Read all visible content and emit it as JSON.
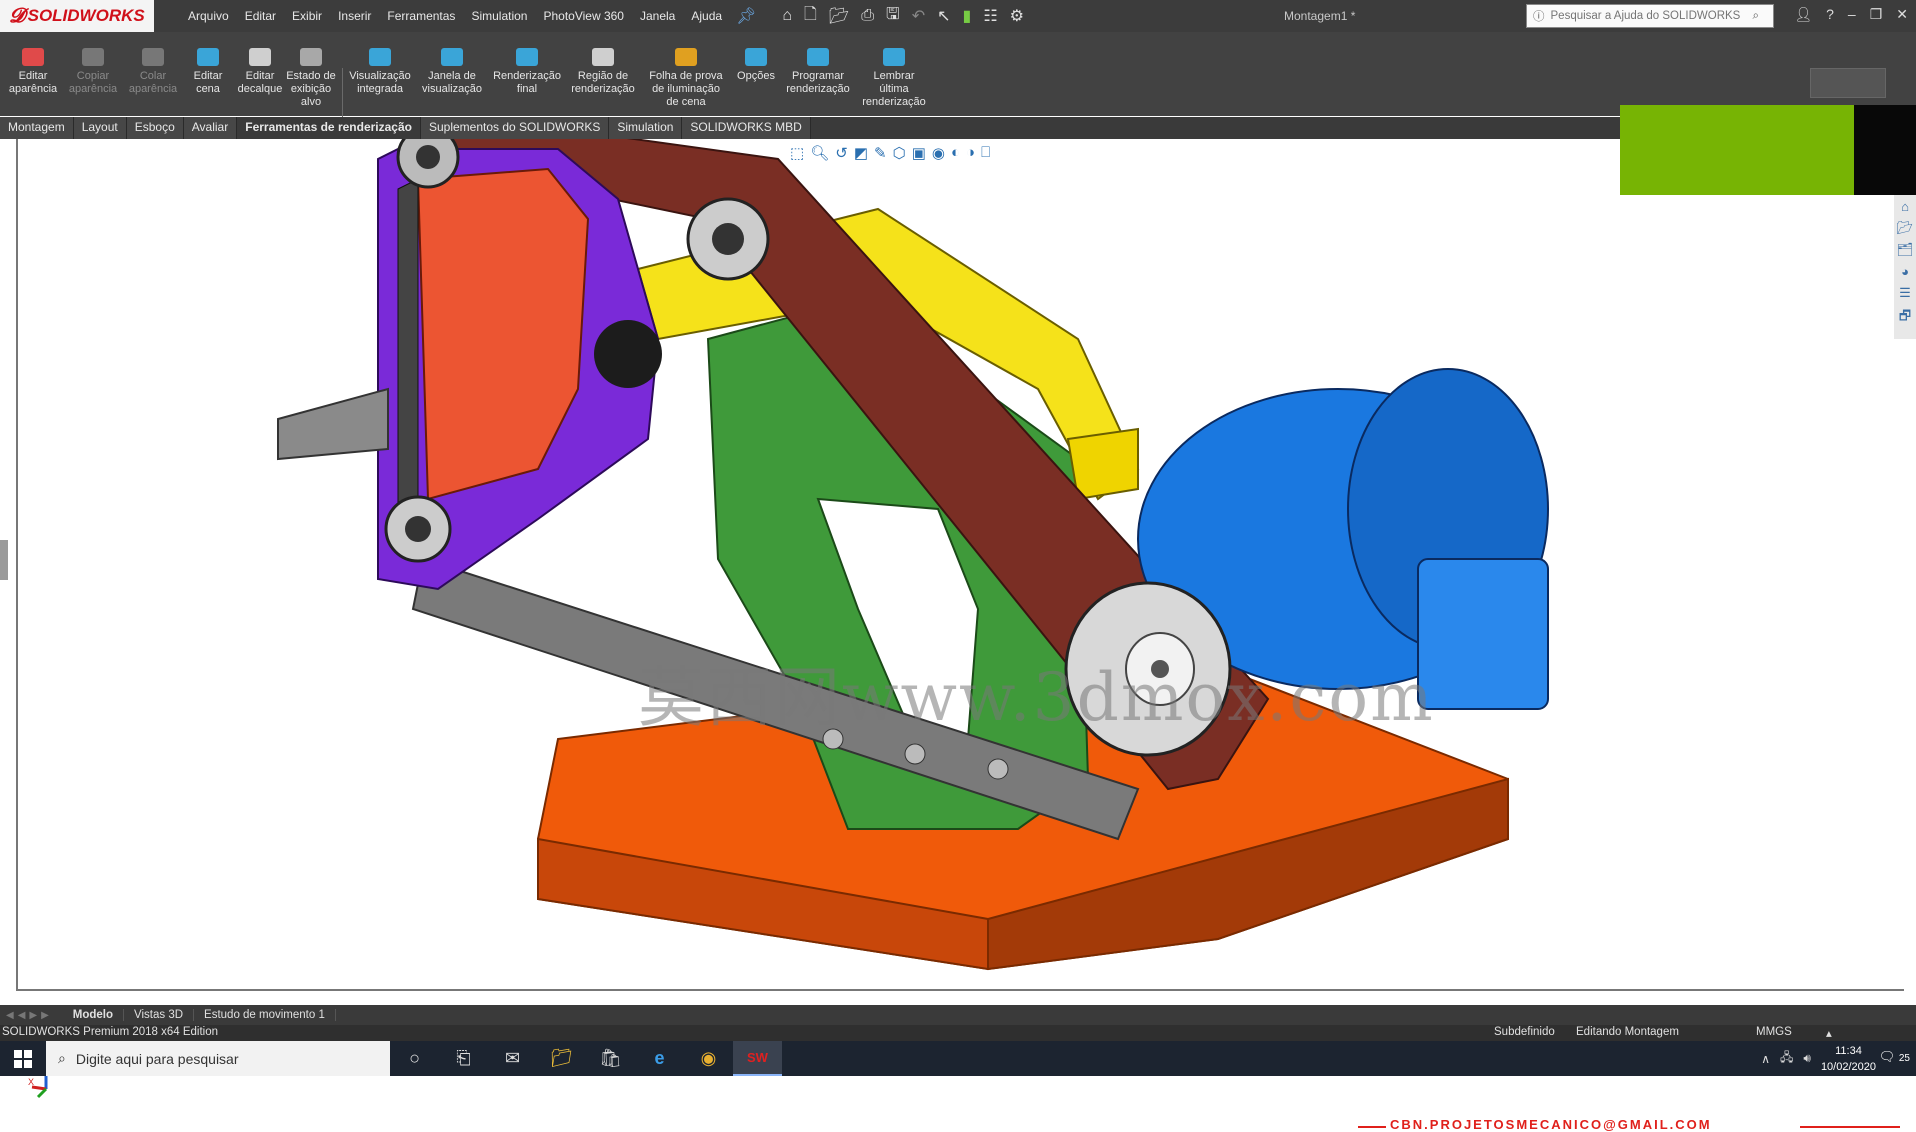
{
  "app": {
    "logo_text": "SOLIDWORKS",
    "document_title": "Montagem1 *",
    "menu": [
      "Arquivo",
      "Editar",
      "Exibir",
      "Inserir",
      "Ferramentas",
      "Simulation",
      "PhotoView 360",
      "Janela",
      "Ajuda"
    ],
    "search_placeholder": "Pesquisar a Ajuda do SOLIDWORKS"
  },
  "commands": [
    {
      "label": "Editar aparência",
      "enabled": true,
      "icon": "edit-appearance-icon",
      "color": "#e04a4a"
    },
    {
      "label": "Copiar aparência",
      "enabled": false,
      "icon": "copy-appearance-icon",
      "color": "#777777"
    },
    {
      "label": "Colar aparência",
      "enabled": false,
      "icon": "paste-appearance-icon",
      "color": "#777777"
    },
    {
      "label": "Editar cena",
      "enabled": true,
      "icon": "edit-scene-icon",
      "color": "#3aa5d8"
    },
    {
      "label": "Editar decalque",
      "enabled": true,
      "icon": "edit-decal-icon",
      "color": "#cfcfcf"
    },
    {
      "label": "Estado de exibição alvo",
      "enabled": true,
      "icon": "display-state-icon",
      "color": "#a8a8a8"
    },
    {
      "label": "Visualização integrada",
      "enabled": true,
      "icon": "integrated-preview-icon",
      "color": "#3aa5d8"
    },
    {
      "label": "Janela de visualização",
      "enabled": true,
      "icon": "preview-window-icon",
      "color": "#3aa5d8"
    },
    {
      "label": "Renderização final",
      "enabled": true,
      "icon": "final-render-icon",
      "color": "#3aa5d8"
    },
    {
      "label": "Região de renderização",
      "enabled": true,
      "icon": "render-region-icon",
      "color": "#cfcfcf"
    },
    {
      "label": "Folha de prova de iluminação de cena",
      "enabled": true,
      "icon": "scene-proofsheet-icon",
      "color": "#e0a020"
    },
    {
      "label": "Opções",
      "enabled": true,
      "icon": "options-icon",
      "color": "#3aa5d8"
    },
    {
      "label": "Programar renderização",
      "enabled": true,
      "icon": "schedule-render-icon",
      "color": "#3aa5d8"
    },
    {
      "label": "Lembrar última renderização",
      "enabled": true,
      "icon": "recall-render-icon",
      "color": "#3aa5d8"
    }
  ],
  "tabs": [
    {
      "label": "Montagem",
      "active": false
    },
    {
      "label": "Layout",
      "active": false
    },
    {
      "label": "Esboço",
      "active": false
    },
    {
      "label": "Avaliar",
      "active": false
    },
    {
      "label": "Ferramentas de renderização",
      "active": true
    },
    {
      "label": "Suplementos do SOLIDWORKS",
      "active": false
    },
    {
      "label": "Simulation",
      "active": false
    },
    {
      "label": "SOLIDWORKS MBD",
      "active": false
    }
  ],
  "viewport": {
    "watermark": "莫西网www.3dmox.com",
    "email": "CBN.PROJETOSMECANICO@GMAIL.COM",
    "triad_label": "Z",
    "triad_x": "X"
  },
  "bottom_tabs": [
    {
      "label": "Modelo",
      "active": true
    },
    {
      "label": "Vistas 3D",
      "active": false
    },
    {
      "label": "Estudo de movimento 1",
      "active": false
    }
  ],
  "status": {
    "edition": "SOLIDWORKS Premium 2018 x64 Edition",
    "state": "Subdefinido",
    "mode": "Editando Montagem",
    "units": "MMGS"
  },
  "taskbar": {
    "search_placeholder": "Digite aqui para pesquisar",
    "time": "11:34",
    "date": "10/02/2020",
    "notifications": "25"
  },
  "colors": {
    "toolbar": "#424242",
    "titlebar": "#3c3c3c",
    "accent_green": "#77b404",
    "solidworks_red": "#d0101a"
  }
}
